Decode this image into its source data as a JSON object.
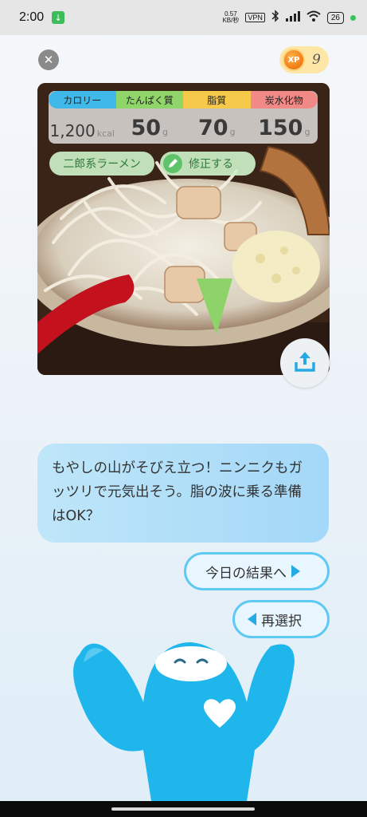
{
  "status_bar": {
    "time": "2:00",
    "net_speed_value": "0.57",
    "net_speed_unit": "KB/秒",
    "vpn": "VPN",
    "battery": "26"
  },
  "header": {
    "xp_badge": "XP",
    "xp_value": "9"
  },
  "nutrition": {
    "labels": [
      "カロリー",
      "たんぱく質",
      "脂質",
      "炭水化物"
    ],
    "calories": {
      "value": "1,200",
      "unit": "kcal"
    },
    "protein": {
      "value": "50",
      "unit": "g"
    },
    "fat": {
      "value": "70",
      "unit": "g"
    },
    "carbs": {
      "value": "150",
      "unit": "g"
    }
  },
  "food_tag": "二郎系ラーメン",
  "edit_label": "修正する",
  "message": "もやしの山がそびえ立つ！ニンニクもガッツリで元気出そう。脂の波に乗る準備はOK？",
  "actions": {
    "next_label": "今日の結果へ",
    "reselect_label": "再選択"
  },
  "colors": {
    "calorie": "#3fb8ea",
    "protein": "#8fd56a",
    "fat": "#f6c94a",
    "carbs": "#f18a86",
    "accent": "#5ec9f2",
    "mascot": "#1fb6ec"
  }
}
